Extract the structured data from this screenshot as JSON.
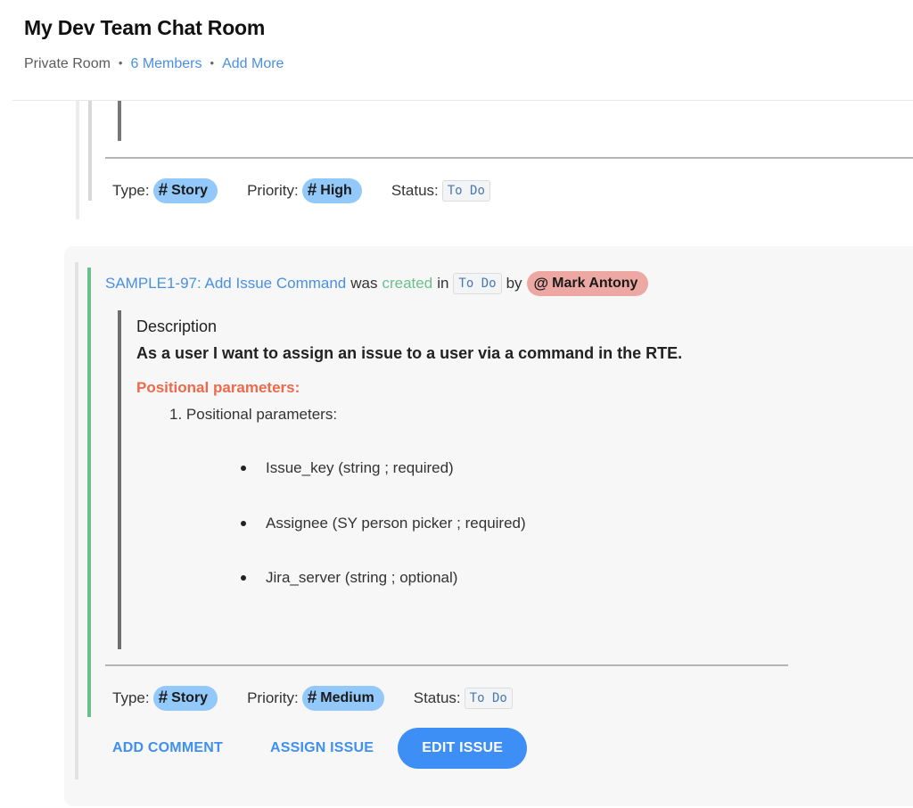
{
  "header": {
    "title": "My Dev Team Chat Room",
    "room_type": "Private Room",
    "members_link": "6 Members",
    "add_more_link": "Add More",
    "separator": "•"
  },
  "previous_message": {
    "meta": {
      "type_label": "Type:",
      "type_value": "Story",
      "priority_label": "Priority:",
      "priority_value": "High",
      "status_label": "Status:",
      "status_value": "To Do"
    }
  },
  "issue_card": {
    "headline": {
      "issue_link": "SAMPLE1-97: Add Issue Command",
      "was": "was",
      "action": "created",
      "in": "in",
      "status_chip": "To Do",
      "by": "by",
      "mention_symbol": "@",
      "author": "Mark Antony"
    },
    "description": {
      "label": "Description",
      "text": "As a user I want to assign an issue to a user via a command in the RTE.",
      "heading": "Positional parameters:",
      "ordered_item": "1. Positional parameters:",
      "bullets": [
        "Issue_key (string ; required)",
        "Assignee (SY person picker ; required)",
        "Jira_server (string ; optional)"
      ]
    },
    "meta": {
      "type_label": "Type:",
      "type_value": "Story",
      "priority_label": "Priority:",
      "priority_value": "Medium",
      "status_label": "Status:",
      "status_value": "To Do"
    },
    "actions": {
      "add_comment": "ADD COMMENT",
      "assign_issue": "ASSIGN ISSUE",
      "edit_issue": "EDIT ISSUE"
    }
  },
  "icons": {
    "hash": "#",
    "tag_icon_name": "hash-icon",
    "mention_icon_name": "at-icon"
  },
  "colors": {
    "link": "#4a90e2",
    "created": "#6cbf8d",
    "pill_bg": "#93c8fa",
    "mention_bg": "#eda8a3",
    "heading_accent": "#ec6a4c",
    "primary_button": "#3e8ff5"
  }
}
